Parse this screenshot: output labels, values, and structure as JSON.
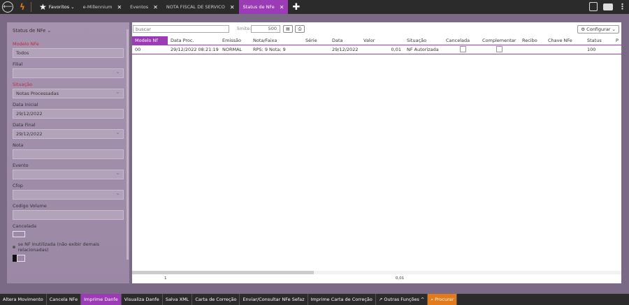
{
  "tabs": {
    "favorites": "Favoritos",
    "items": [
      {
        "label": "e-Millennium"
      },
      {
        "label": "Eventos"
      },
      {
        "label": "NOTA FISCAL DE SERVICO"
      },
      {
        "label": "Status de NFe"
      }
    ]
  },
  "filters": {
    "title": "Status de NFe",
    "modelo_label": "Modelo NFe",
    "modelo_value": "Todos",
    "filial_label": "Filial",
    "situacao_label": "Situação",
    "situacao_value": "Notas Processadas",
    "data_inicial_label": "Data Inicial",
    "data_inicial_value": "29/12/2022",
    "data_final_label": "Data Final",
    "data_final_value": "29/12/2022",
    "nota_label": "Nota",
    "evento_label": "Evento",
    "cfop_label": "Cfop",
    "codigo_volume_label": "Codigo Volume",
    "cancelada_label": "Cancelada",
    "inutilizada_label": "se NF Inutilizada (não exibir demais relacionadas)"
  },
  "toolbar": {
    "search_placeholder": "buscar",
    "limite_label": "limite:",
    "limite_value": "500",
    "configurar_label": "⚙ Configurar ⌄"
  },
  "table": {
    "columns": [
      "Modelo Nf",
      "Data Proc.",
      "Emissão",
      "Nota/Faixa",
      "Série",
      "Data",
      "Valor",
      "Situação",
      "Cancelada",
      "Complementar",
      "Recibo",
      "Chave NFe",
      "Status",
      "P"
    ],
    "row": {
      "modelo": "00",
      "data_proc": "29/12/2022 08:21:19",
      "emissao": "NORMAL",
      "nota_faixa": "RPS: 9 Nota: 9",
      "serie": "",
      "data": "29/12/2022",
      "valor": "0,01",
      "situacao": "NF Autorizada",
      "recibo": "",
      "chave": "",
      "status": "100"
    },
    "footer_count": "1",
    "footer_total": "0,01"
  },
  "actions": [
    "Altera Movimento",
    "Cancela NFe",
    "Imprime Danfe",
    "Visualiza Danfe",
    "Salva XML",
    "Carta de Correção",
    "Enviar/Consultar NFe Sefaz",
    "Imprime Carta de Correção",
    "Outras Funções ^",
    "Procurar"
  ],
  "colors": {
    "accent": "#9b3bb5",
    "orange": "#e37b1a",
    "bar": "#2b2b2b"
  }
}
